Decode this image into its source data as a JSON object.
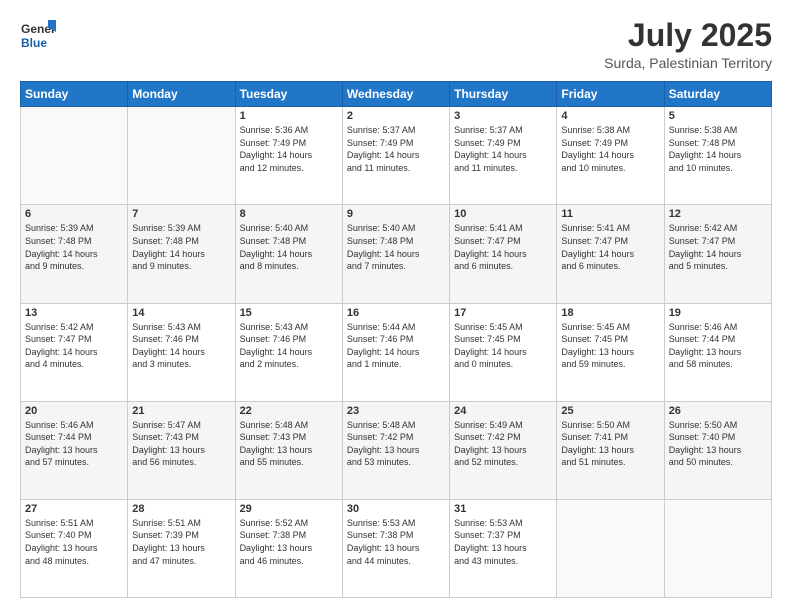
{
  "header": {
    "logo_line1": "General",
    "logo_line2": "Blue",
    "title": "July 2025",
    "subtitle": "Surda, Palestinian Territory"
  },
  "weekdays": [
    "Sunday",
    "Monday",
    "Tuesday",
    "Wednesday",
    "Thursday",
    "Friday",
    "Saturday"
  ],
  "weeks": [
    [
      {
        "day": "",
        "info": ""
      },
      {
        "day": "",
        "info": ""
      },
      {
        "day": "1",
        "info": "Sunrise: 5:36 AM\nSunset: 7:49 PM\nDaylight: 14 hours\nand 12 minutes."
      },
      {
        "day": "2",
        "info": "Sunrise: 5:37 AM\nSunset: 7:49 PM\nDaylight: 14 hours\nand 11 minutes."
      },
      {
        "day": "3",
        "info": "Sunrise: 5:37 AM\nSunset: 7:49 PM\nDaylight: 14 hours\nand 11 minutes."
      },
      {
        "day": "4",
        "info": "Sunrise: 5:38 AM\nSunset: 7:49 PM\nDaylight: 14 hours\nand 10 minutes."
      },
      {
        "day": "5",
        "info": "Sunrise: 5:38 AM\nSunset: 7:48 PM\nDaylight: 14 hours\nand 10 minutes."
      }
    ],
    [
      {
        "day": "6",
        "info": "Sunrise: 5:39 AM\nSunset: 7:48 PM\nDaylight: 14 hours\nand 9 minutes."
      },
      {
        "day": "7",
        "info": "Sunrise: 5:39 AM\nSunset: 7:48 PM\nDaylight: 14 hours\nand 9 minutes."
      },
      {
        "day": "8",
        "info": "Sunrise: 5:40 AM\nSunset: 7:48 PM\nDaylight: 14 hours\nand 8 minutes."
      },
      {
        "day": "9",
        "info": "Sunrise: 5:40 AM\nSunset: 7:48 PM\nDaylight: 14 hours\nand 7 minutes."
      },
      {
        "day": "10",
        "info": "Sunrise: 5:41 AM\nSunset: 7:47 PM\nDaylight: 14 hours\nand 6 minutes."
      },
      {
        "day": "11",
        "info": "Sunrise: 5:41 AM\nSunset: 7:47 PM\nDaylight: 14 hours\nand 6 minutes."
      },
      {
        "day": "12",
        "info": "Sunrise: 5:42 AM\nSunset: 7:47 PM\nDaylight: 14 hours\nand 5 minutes."
      }
    ],
    [
      {
        "day": "13",
        "info": "Sunrise: 5:42 AM\nSunset: 7:47 PM\nDaylight: 14 hours\nand 4 minutes."
      },
      {
        "day": "14",
        "info": "Sunrise: 5:43 AM\nSunset: 7:46 PM\nDaylight: 14 hours\nand 3 minutes."
      },
      {
        "day": "15",
        "info": "Sunrise: 5:43 AM\nSunset: 7:46 PM\nDaylight: 14 hours\nand 2 minutes."
      },
      {
        "day": "16",
        "info": "Sunrise: 5:44 AM\nSunset: 7:46 PM\nDaylight: 14 hours\nand 1 minute."
      },
      {
        "day": "17",
        "info": "Sunrise: 5:45 AM\nSunset: 7:45 PM\nDaylight: 14 hours\nand 0 minutes."
      },
      {
        "day": "18",
        "info": "Sunrise: 5:45 AM\nSunset: 7:45 PM\nDaylight: 13 hours\nand 59 minutes."
      },
      {
        "day": "19",
        "info": "Sunrise: 5:46 AM\nSunset: 7:44 PM\nDaylight: 13 hours\nand 58 minutes."
      }
    ],
    [
      {
        "day": "20",
        "info": "Sunrise: 5:46 AM\nSunset: 7:44 PM\nDaylight: 13 hours\nand 57 minutes."
      },
      {
        "day": "21",
        "info": "Sunrise: 5:47 AM\nSunset: 7:43 PM\nDaylight: 13 hours\nand 56 minutes."
      },
      {
        "day": "22",
        "info": "Sunrise: 5:48 AM\nSunset: 7:43 PM\nDaylight: 13 hours\nand 55 minutes."
      },
      {
        "day": "23",
        "info": "Sunrise: 5:48 AM\nSunset: 7:42 PM\nDaylight: 13 hours\nand 53 minutes."
      },
      {
        "day": "24",
        "info": "Sunrise: 5:49 AM\nSunset: 7:42 PM\nDaylight: 13 hours\nand 52 minutes."
      },
      {
        "day": "25",
        "info": "Sunrise: 5:50 AM\nSunset: 7:41 PM\nDaylight: 13 hours\nand 51 minutes."
      },
      {
        "day": "26",
        "info": "Sunrise: 5:50 AM\nSunset: 7:40 PM\nDaylight: 13 hours\nand 50 minutes."
      }
    ],
    [
      {
        "day": "27",
        "info": "Sunrise: 5:51 AM\nSunset: 7:40 PM\nDaylight: 13 hours\nand 48 minutes."
      },
      {
        "day": "28",
        "info": "Sunrise: 5:51 AM\nSunset: 7:39 PM\nDaylight: 13 hours\nand 47 minutes."
      },
      {
        "day": "29",
        "info": "Sunrise: 5:52 AM\nSunset: 7:38 PM\nDaylight: 13 hours\nand 46 minutes."
      },
      {
        "day": "30",
        "info": "Sunrise: 5:53 AM\nSunset: 7:38 PM\nDaylight: 13 hours\nand 44 minutes."
      },
      {
        "day": "31",
        "info": "Sunrise: 5:53 AM\nSunset: 7:37 PM\nDaylight: 13 hours\nand 43 minutes."
      },
      {
        "day": "",
        "info": ""
      },
      {
        "day": "",
        "info": ""
      }
    ]
  ]
}
